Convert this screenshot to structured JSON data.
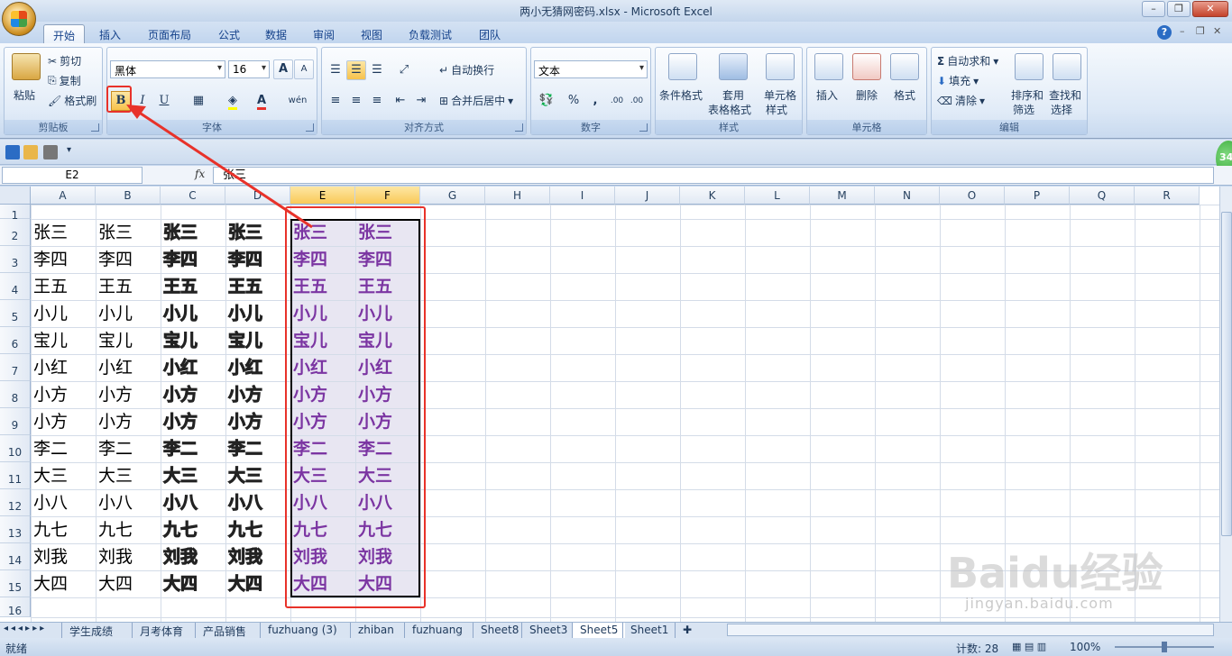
{
  "window": {
    "title": "两小无猜网密码.xlsx - Microsoft Excel"
  },
  "tabs": [
    "开始",
    "插入",
    "页面布局",
    "公式",
    "数据",
    "审阅",
    "视图",
    "负载测试",
    "团队"
  ],
  "ribbon": {
    "clipboard": {
      "label": "剪贴板",
      "paste": "粘贴",
      "cut": "剪切",
      "copy": "复制",
      "format_painter": "格式刷"
    },
    "font": {
      "label": "字体",
      "font_name": "黑体",
      "font_size": "16",
      "bold": "B",
      "italic": "I",
      "underline": "U",
      "grow": "A",
      "shrink": "A",
      "phonetic": "wén"
    },
    "alignment": {
      "label": "对齐方式",
      "wrap": "自动换行",
      "merge": "合并后居中"
    },
    "number": {
      "label": "数字",
      "format": "文本",
      "percent": "%",
      "comma": ",",
      "inc_decimal": ".00",
      "dec_decimal": ".00"
    },
    "styles": {
      "label": "样式",
      "conditional": "条件格式",
      "table_line1": "套用",
      "table_line2": "表格格式",
      "cell_style_line1": "单元格",
      "cell_style_line2": "样式"
    },
    "cells": {
      "label": "单元格",
      "insert": "插入",
      "delete": "删除",
      "format": "格式"
    },
    "editing": {
      "label": "编辑",
      "autosum": "自动求和",
      "fill": "填充",
      "clear": "清除",
      "sort_line1": "排序和",
      "sort_line2": "筛选",
      "find_line1": "查找和",
      "find_line2": "选择"
    }
  },
  "formula_bar": {
    "name_box": "E2",
    "fx": "fx",
    "content": "张三"
  },
  "columns": [
    "A",
    "B",
    "C",
    "D",
    "E",
    "F",
    "G",
    "H",
    "I",
    "J",
    "K",
    "L",
    "M",
    "N",
    "O",
    "P",
    "Q",
    "R"
  ],
  "rows": [
    {
      "num": "1",
      "value": ""
    },
    {
      "num": "2",
      "value": "张三"
    },
    {
      "num": "3",
      "value": "李四"
    },
    {
      "num": "4",
      "value": "王五"
    },
    {
      "num": "5",
      "value": "小儿"
    },
    {
      "num": "6",
      "value": "宝儿"
    },
    {
      "num": "7",
      "value": "小红"
    },
    {
      "num": "8",
      "value": "小方"
    },
    {
      "num": "9",
      "value": "小方"
    },
    {
      "num": "10",
      "value": "李二"
    },
    {
      "num": "11",
      "value": "大三"
    },
    {
      "num": "12",
      "value": "小八"
    },
    {
      "num": "13",
      "value": "九七"
    },
    {
      "num": "14",
      "value": "刘我"
    },
    {
      "num": "15",
      "value": "大四"
    },
    {
      "num": "16",
      "value": ""
    }
  ],
  "sheets": [
    "学生成绩",
    "月考体育",
    "产品销售",
    "fuzhuang (3)",
    "zhiban",
    "fuzhuang",
    "Sheet8",
    "Sheet3",
    "Sheet5",
    "Sheet1"
  ],
  "active_sheet": "Sheet5",
  "status": {
    "ready": "就绪",
    "count": "计数: 28",
    "zoom": "100%"
  },
  "badge": "34",
  "watermark": {
    "brand": "Baidu经验",
    "url": "jingyan.baidu.com"
  },
  "colors": {
    "selected_text": "#7b35a2",
    "highlight_box": "#e8322a"
  }
}
